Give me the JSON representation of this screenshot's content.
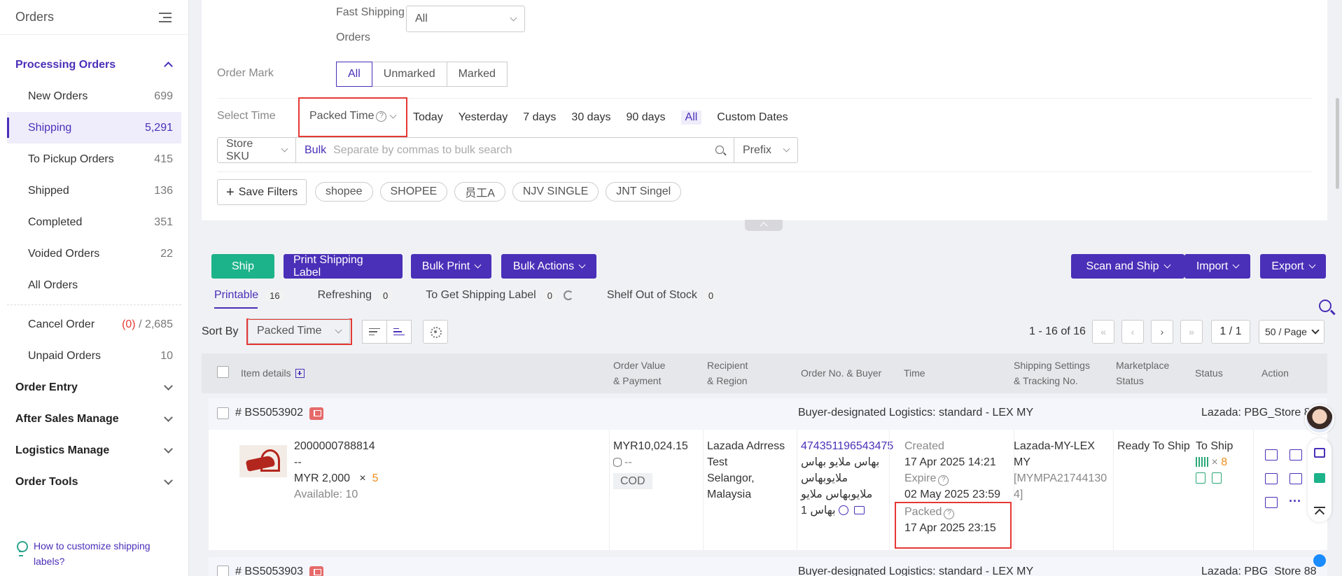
{
  "sidebar": {
    "title": "Orders",
    "groups": [
      {
        "label": "Processing Orders"
      },
      {
        "label": "Order Entry"
      },
      {
        "label": "After Sales Manage"
      },
      {
        "label": "Logistics Manage"
      },
      {
        "label": "Order Tools"
      }
    ],
    "items": [
      {
        "label": "New Orders",
        "count": "699"
      },
      {
        "label": "Shipping",
        "count": "5,291"
      },
      {
        "label": "To Pickup Orders",
        "count": "415"
      },
      {
        "label": "Shipped",
        "count": "136"
      },
      {
        "label": "Completed",
        "count": "351"
      },
      {
        "label": "Voided Orders",
        "count": "22"
      },
      {
        "label": "All Orders",
        "count": ""
      }
    ],
    "cancel": {
      "label": "Cancel Order",
      "count_red": "(0)",
      "count_rest": " / 2,685"
    },
    "unpaid": {
      "label": "Unpaid Orders",
      "count": "10"
    },
    "help": "How to customize shipping labels?"
  },
  "filters": {
    "fast_shipping_label": "Fast Shipping Orders",
    "fast_shipping_line1": "Fast Shipping",
    "fast_shipping_line2": "Orders",
    "fast_shipping_value": "All",
    "order_mark_label": "Order Mark",
    "order_mark_options": [
      "All",
      "Unmarked",
      "Marked"
    ],
    "select_time_label": "Select Time",
    "time_type": "Packed Time",
    "time_options": [
      "Today",
      "Yesterday",
      "7 days",
      "30 days",
      "90 days",
      "All",
      "Custom Dates"
    ],
    "search_field": "Store SKU",
    "bulk_label": "Bulk",
    "search_placeholder": "Separate by commas to bulk search",
    "match_mode": "Prefix",
    "save_filters": "Save Filters",
    "saved_tags": [
      "shopee",
      "SHOPEE",
      "员工A",
      "NJV SINGLE",
      "JNT Singel"
    ]
  },
  "actions": {
    "ship": "Ship",
    "print_label": "Print Shipping Label",
    "bulk_print": "Bulk Print",
    "bulk_actions": "Bulk Actions",
    "scan_ship": "Scan and Ship",
    "import": "Import",
    "export": "Export"
  },
  "subtabs": [
    {
      "label": "Printable",
      "count": "16"
    },
    {
      "label": "Refreshing",
      "count": "0"
    },
    {
      "label": "To Get Shipping Label",
      "count": "0"
    },
    {
      "label": "Shelf Out of Stock",
      "count": "0"
    }
  ],
  "sort": {
    "label": "Sort By",
    "value": "Packed Time"
  },
  "pager": {
    "info": "1 - 16 of 16",
    "page": "1 / 1",
    "size": "50 / Page"
  },
  "table": {
    "columns": {
      "item": "Item details",
      "value_1": "Order Value",
      "value_2": "& Payment",
      "recipient_1": "Recipient",
      "recipient_2": "& Region",
      "orderno": "Order No. & Buyer",
      "time": "Time",
      "ship_1": "Shipping Settings",
      "ship_2": "& Tracking No.",
      "mkt_1": "Marketplace",
      "mkt_2": "Status",
      "status": "Status",
      "action": "Action"
    },
    "orders": [
      {
        "id": "# BS5053902",
        "logistics": "Buyer-designated Logistics: standard - LEX MY",
        "store": "Lazada: PBG_Store 88",
        "sku": "2000000788814",
        "dash": "--",
        "price": "MYR 2,000",
        "times": "×",
        "qty": "5",
        "available": "Available: 10",
        "order_value": "MYR10,024.15",
        "value_sub": "--",
        "payment": "COD",
        "recipient_1": "Lazada Adrress",
        "recipient_2": "Test",
        "region_1": "Selangor,",
        "region_2": "Malaysia",
        "order_no": "474351196543475",
        "buyer_1": "بهاس ملايو بهاس",
        "buyer_2": "ملايوبهاس",
        "buyer_3": "ملايوبهاس ملايو",
        "buyer_4": "بهاس 1",
        "created_label": "Created",
        "created": "17 Apr 2025 14:21",
        "expire_label": "Expire",
        "expire": "02 May 2025 23:59",
        "packed_label": "Packed",
        "packed": "17 Apr 2025 23:15",
        "ship_1": "Lazada-MY-LEX",
        "ship_2": "MY",
        "tracking_1": "[MYMPA21744130",
        "tracking_2": "4]",
        "marketplace_status": "Ready To Ship",
        "status": "To Ship",
        "status_qty": "8"
      },
      {
        "id": "# BS5053903",
        "logistics": "Buyer-designated Logistics: standard - LEX MY",
        "store": "Lazada: PBG_Store 88"
      }
    ]
  }
}
